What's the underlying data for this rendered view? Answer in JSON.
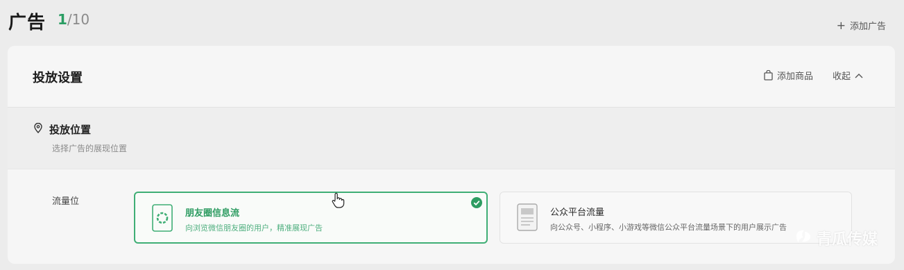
{
  "header": {
    "title": "广告",
    "count_current": "1",
    "count_total": "/10",
    "add_ad_label": "添加广告"
  },
  "delivery": {
    "title": "投放设置",
    "add_product_label": "添加商品",
    "collapse_label": "收起",
    "placement": {
      "title": "投放位置",
      "subtitle": "选择广告的展现位置",
      "row_label": "流量位",
      "options": [
        {
          "title": "朋友圈信息流",
          "desc": "向浏览微信朋友圈的用户，精准展现广告",
          "selected": true
        },
        {
          "title": "公众平台流量",
          "desc": "向公众号、小程序、小游戏等微信公众平台流量场景下的用户展示广告",
          "selected": false
        }
      ]
    }
  },
  "watermark": {
    "text": "青瓜传媒"
  },
  "colors": {
    "accent": "#2e9c62",
    "border_selected": "#3fae75",
    "background": "#ececec"
  }
}
